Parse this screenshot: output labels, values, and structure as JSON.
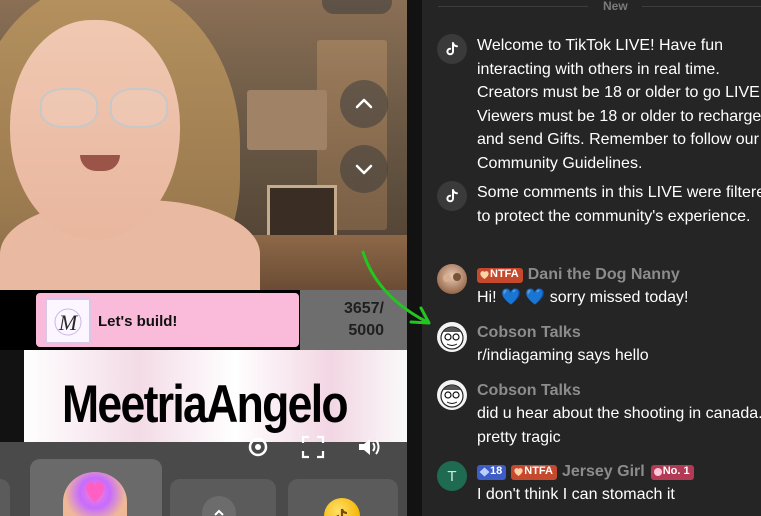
{
  "chat": {
    "divider_label": "New",
    "messages": [
      {
        "type": "system",
        "avatar_icon": "tiktok-logo-icon",
        "text": "Welcome to TikTok LIVE! Have fun interacting with others in real time. Creators must be 18 or older to go LIVE. Viewers must be 18 or older to recharge and send Gifts. Remember to follow our Community Guidelines."
      },
      {
        "type": "system",
        "avatar_icon": "tiktok-logo-icon",
        "text": "Some comments in this LIVE were filtered to protect the community's experience."
      },
      {
        "type": "user",
        "badge": "NTFA",
        "username": "Dani the Dog Nanny",
        "text": "Hi!",
        "text_end": "sorry missed today!",
        "emoji": "💙"
      },
      {
        "type": "user",
        "username": "Cobson Talks",
        "text": "r/indiagaming says hello"
      },
      {
        "type": "user",
        "username": "Cobson Talks",
        "text": "did u hear about the shooting in canada... pretty tragic"
      },
      {
        "type": "user",
        "avatar_letter": "T",
        "level_badge": "18",
        "badge": "NTFA",
        "username": "Jersey Girl",
        "rank_badge": "No. 1",
        "text": "I don't think I can stomach it"
      }
    ]
  },
  "stream": {
    "goal_label": "Let's build!",
    "goal_current": "3657/",
    "goal_target": "5000",
    "banner_text": "MeetriaAngelo",
    "goal_avatar_letter": "M"
  },
  "colors": {
    "chat_bg": "#252525",
    "ntfa_badge": "#c5492c",
    "level_badge": "#3d5dc7",
    "rank_badge": "#b33a55",
    "goal_card": "#f9bbd9",
    "annotation_arrow": "#22c61f"
  }
}
